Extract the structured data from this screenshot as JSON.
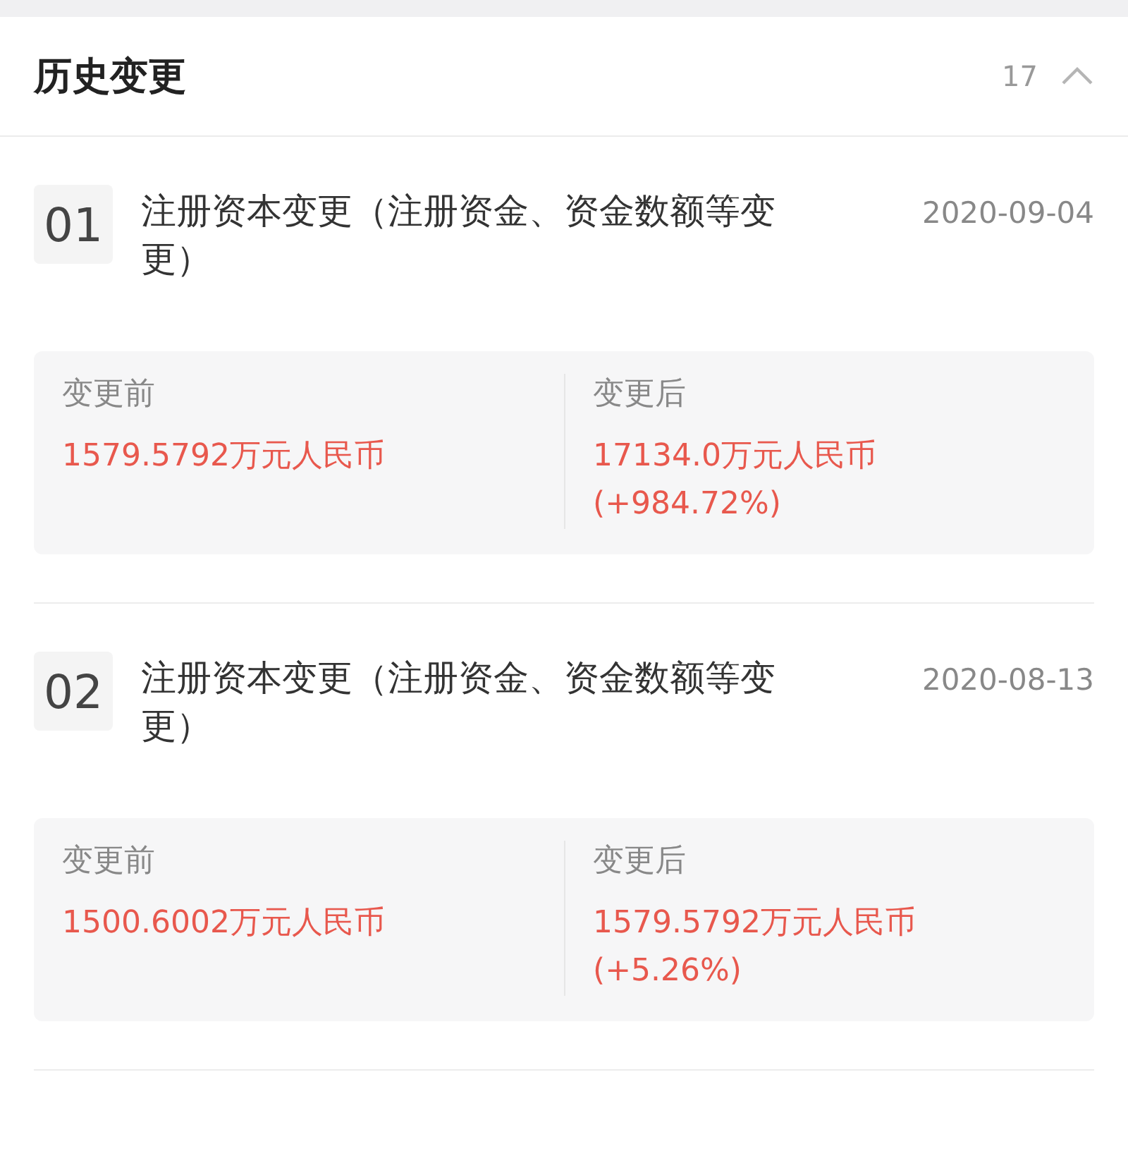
{
  "section": {
    "title": "历史变更",
    "count": "17",
    "expanded": true
  },
  "changes": [
    {
      "index": "01",
      "title": "注册资本变更（注册资金、资金数额等变更）",
      "date": "2020-09-04",
      "before": {
        "label": "变更前",
        "value": "1579.5792万元人民币"
      },
      "after": {
        "label": "变更后",
        "value": "17134.0万元人民币",
        "change": "(+984.72%)"
      }
    },
    {
      "index": "02",
      "title": "注册资本变更（注册资金、资金数额等变更）",
      "date": "2020-08-13",
      "before": {
        "label": "变更前",
        "value": "1500.6002万元人民币"
      },
      "after": {
        "label": "变更后",
        "value": "1579.5792万元人民币",
        "change": "(+5.26%)"
      }
    }
  ]
}
